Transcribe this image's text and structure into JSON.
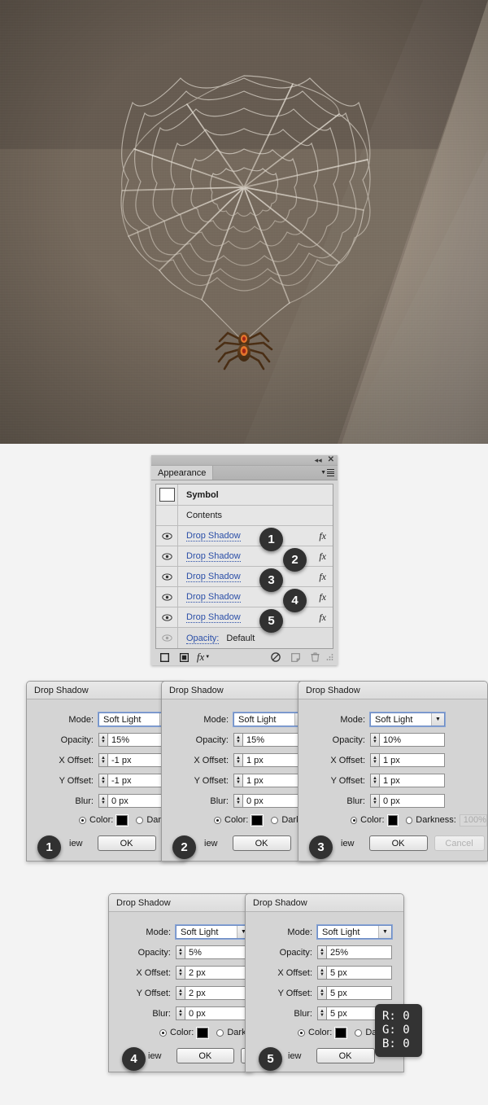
{
  "illustration": {
    "name": "spider-web-wall-corner-illustration",
    "background_color": "#75695c",
    "wall_top_color": "#665b50",
    "wall_shadow_color": "#8a7d6e",
    "web_color": "#cfc7bb",
    "spider_body_color": "#5a3a1c",
    "spider_marking_color": "#e8762a",
    "web_spokes": 14,
    "web_rings": 7
  },
  "appearance_panel": {
    "tab_label": "Appearance",
    "topbar": {
      "collapse_icon": "double-chevron-left-icon",
      "close_icon": "close-icon",
      "menu_icon": "panel-menu-icon"
    },
    "rows": [
      {
        "label": "Symbol",
        "type": "target",
        "has_swatch": true
      },
      {
        "label": "Contents",
        "type": "contents"
      },
      {
        "label": "Drop Shadow",
        "type": "effect",
        "fx": "fx",
        "badge": "1"
      },
      {
        "label": "Drop Shadow",
        "type": "effect",
        "fx": "fx",
        "badge": "2"
      },
      {
        "label": "Drop Shadow",
        "type": "effect",
        "fx": "fx",
        "badge": "3"
      },
      {
        "label": "Drop Shadow",
        "type": "effect",
        "fx": "fx",
        "badge": "4"
      },
      {
        "label": "Drop Shadow",
        "type": "effect",
        "fx": "fx",
        "badge": "5"
      }
    ],
    "opacity_row": {
      "label": "Opacity:",
      "value": "Default"
    },
    "footer_icons": [
      "new-stroke-icon",
      "new-fill-icon",
      "add-effect-icon",
      "clear-appearance-icon",
      "duplicate-item-icon",
      "delete-item-icon",
      "resize-grip-icon"
    ]
  },
  "dialogs": [
    {
      "badge": "1",
      "title": "Drop Shadow",
      "mode_label": "Mode:",
      "mode_value": "Soft Light",
      "opacity_label": "Opacity:",
      "opacity_value": "15%",
      "xoffset_label": "X Offset:",
      "xoffset_value": "-1 px",
      "yoffset_label": "Y Offset:",
      "yoffset_value": "-1 px",
      "blur_label": "Blur:",
      "blur_value": "0 px",
      "color_label": "Color:",
      "color_value": "#000000",
      "darkness_label": "Darkn",
      "darkness_value": "",
      "preview_label": "iew",
      "ok_label": "OK",
      "cancel_label": ""
    },
    {
      "badge": "2",
      "title": "Drop Shadow",
      "mode_label": "Mode:",
      "mode_value": "Soft Light",
      "opacity_label": "Opacity:",
      "opacity_value": "15%",
      "xoffset_label": "X Offset:",
      "xoffset_value": "1 px",
      "yoffset_label": "Y Offset:",
      "yoffset_value": "1 px",
      "blur_label": "Blur:",
      "blur_value": "0 px",
      "color_label": "Color:",
      "color_value": "#000000",
      "darkness_label": "Darkn",
      "darkness_value": "",
      "preview_label": "iew",
      "ok_label": "OK",
      "cancel_label": ""
    },
    {
      "badge": "3",
      "title": "Drop Shadow",
      "mode_label": "Mode:",
      "mode_value": "Soft Light",
      "opacity_label": "Opacity:",
      "opacity_value": "10%",
      "xoffset_label": "X Offset:",
      "xoffset_value": "1 px",
      "yoffset_label": "Y Offset:",
      "yoffset_value": "1 px",
      "blur_label": "Blur:",
      "blur_value": "0 px",
      "color_label": "Color:",
      "color_value": "#000000",
      "darkness_label": "Darkness:",
      "darkness_value": "100%",
      "preview_label": "iew",
      "ok_label": "OK",
      "cancel_label": "Cancel"
    },
    {
      "badge": "4",
      "title": "Drop Shadow",
      "mode_label": "Mode:",
      "mode_value": "Soft Light",
      "opacity_label": "Opacity:",
      "opacity_value": "5%",
      "xoffset_label": "X Offset:",
      "xoffset_value": "2 px",
      "yoffset_label": "Y Offset:",
      "yoffset_value": "2 px",
      "blur_label": "Blur:",
      "blur_value": "0 px",
      "color_label": "Color:",
      "color_value": "#000000",
      "darkness_label": "Darkn",
      "darkness_value": "",
      "preview_label": "iew",
      "ok_label": "OK",
      "cancel_label": ""
    },
    {
      "badge": "5",
      "title": "Drop Shadow",
      "mode_label": "Mode:",
      "mode_value": "Soft Light",
      "opacity_label": "Opacity:",
      "opacity_value": "25%",
      "xoffset_label": "X Offset:",
      "xoffset_value": "5 px",
      "yoffset_label": "Y Offset:",
      "yoffset_value": "5 px",
      "blur_label": "Blur:",
      "blur_value": "5 px",
      "color_label": "Color:",
      "color_value": "#000000",
      "darkness_label": "Dark",
      "darkness_value": "",
      "preview_label": "iew",
      "ok_label": "OK",
      "cancel_label": ""
    }
  ],
  "rgb_tooltip": {
    "r": "R: 0",
    "g": "G: 0",
    "b": "B: 0"
  }
}
